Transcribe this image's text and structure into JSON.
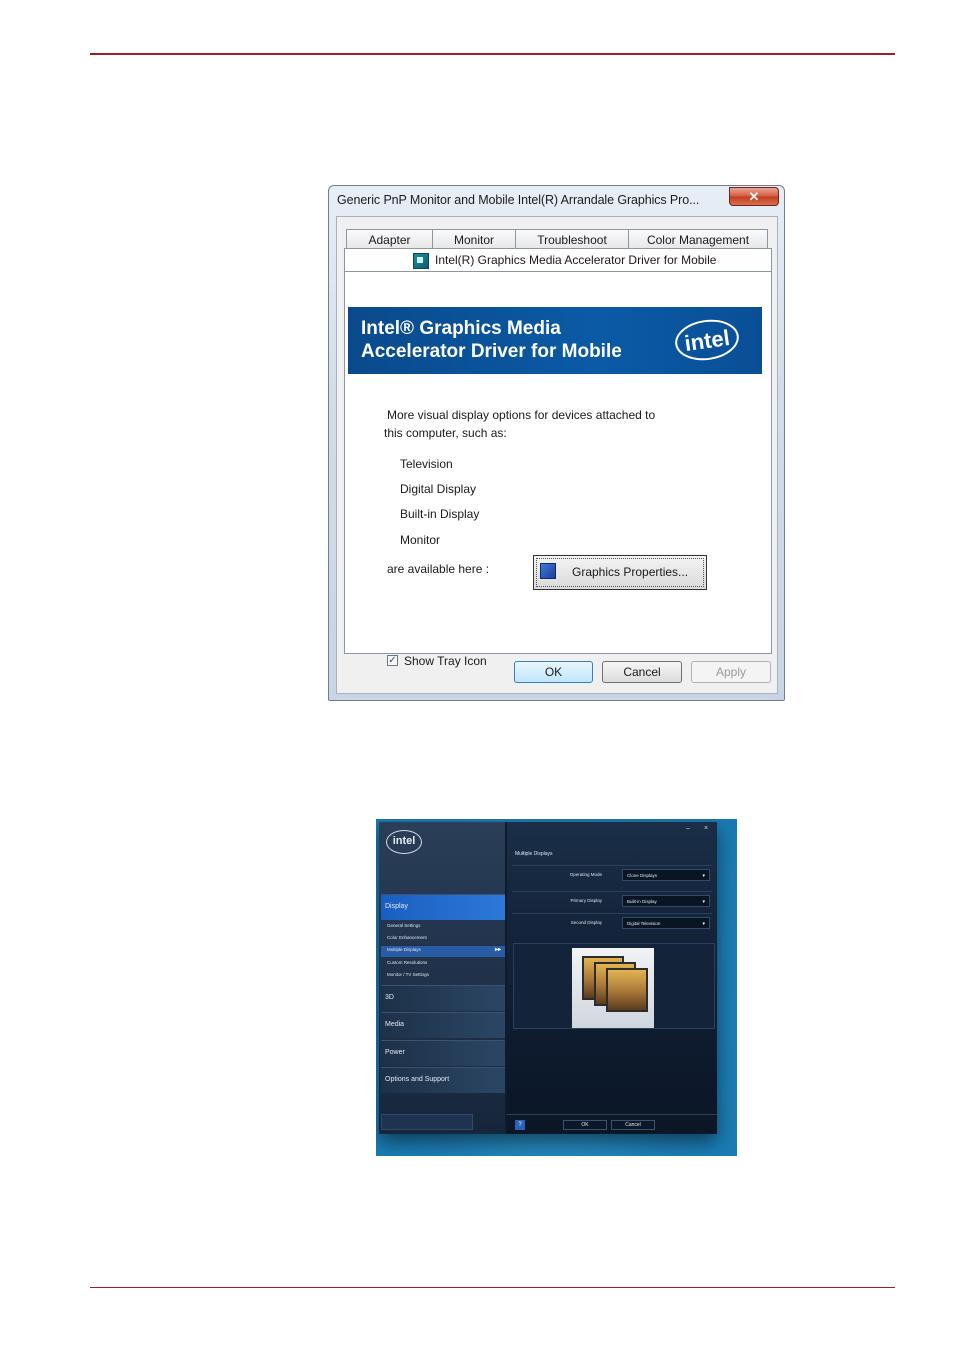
{
  "dialog": {
    "title": "Generic PnP Monitor and Mobile Intel(R) Arrandale Graphics Pro...",
    "close_glyph": "✕",
    "tabs": [
      "Adapter",
      "Monitor",
      "Troubleshoot",
      "Color Management"
    ],
    "active_tab": "Intel(R) Graphics Media Accelerator Driver for Mobile",
    "banner": {
      "line1": "Intel® Graphics Media",
      "line2": "Accelerator Driver for Mobile",
      "logo": "intel"
    },
    "intro_line1": "More visual display options for devices attached to",
    "intro_line2": "this computer, such as:",
    "devices": [
      "Television",
      "Digital Display",
      "Built-in Display",
      "Monitor"
    ],
    "available_label": "are available here :",
    "graphics_button": "Graphics Properties...",
    "tray_checkbox": {
      "label": "Show Tray Icon",
      "checked": true,
      "mark": "✓"
    },
    "buttons": {
      "ok": "OK",
      "cancel": "Cancel",
      "apply": "Apply"
    }
  },
  "intel_panel": {
    "logo": "intel",
    "window_controls": {
      "minimize": "–",
      "close": "×"
    },
    "categories": {
      "display": "Display",
      "three_d": "3D",
      "media": "Media",
      "power": "Power",
      "options": "Options and Support"
    },
    "display_subitems": [
      "General Settings",
      "Color Enhancement",
      "Multiple Displays",
      "Custom Resolutions",
      "Monitor / TV Settings"
    ],
    "active_subitem_arrow": "▸▸",
    "heading": "Multiple Displays",
    "fields": [
      {
        "label": "Operating Mode",
        "value": "Clone Displays"
      },
      {
        "label": "Primary Display",
        "value": "Built-in Display"
      },
      {
        "label": "Second Display",
        "value": "Digital Television"
      }
    ],
    "dropdown_glyph": "▾",
    "help": "?",
    "ok": "OK",
    "cancel": "Cancel"
  }
}
